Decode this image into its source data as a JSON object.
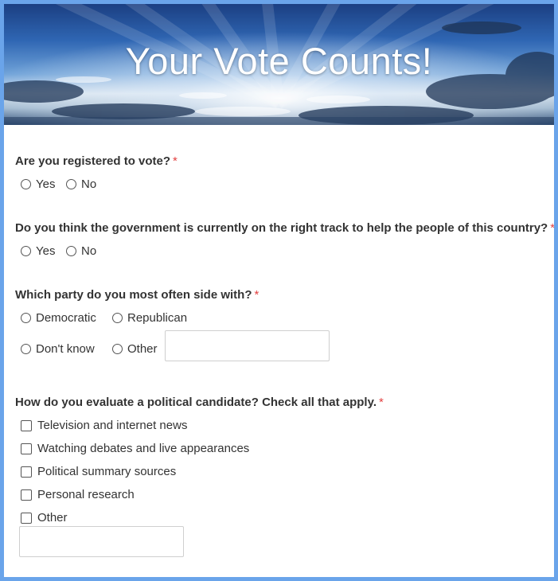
{
  "header": {
    "title": "Your Vote Counts!"
  },
  "questions": [
    {
      "label": "Are you registered to vote?",
      "required": "*",
      "options": [
        "Yes",
        "No"
      ]
    },
    {
      "label": "Do you think the government is currently on the right track to help the people of this country?",
      "required": "*",
      "options": [
        "Yes",
        "No"
      ]
    },
    {
      "label": "Which party do you most often side with?",
      "required": "*",
      "options": [
        "Democratic",
        "Republican",
        "Don't know",
        "Other"
      ],
      "other_value": ""
    },
    {
      "label": "How do you evaluate a political candidate? Check all that apply.",
      "required": "*",
      "options": [
        "Television and internet news",
        "Watching debates and live appearances",
        "Political summary sources",
        "Personal research",
        "Other"
      ],
      "other_value": ""
    }
  ],
  "colors": {
    "required": "#e34141",
    "frame_border": "#6aa4ea",
    "text": "#333333"
  },
  "icons": {
    "radio": "radio-unchecked-icon",
    "checkbox": "checkbox-unchecked-icon"
  }
}
